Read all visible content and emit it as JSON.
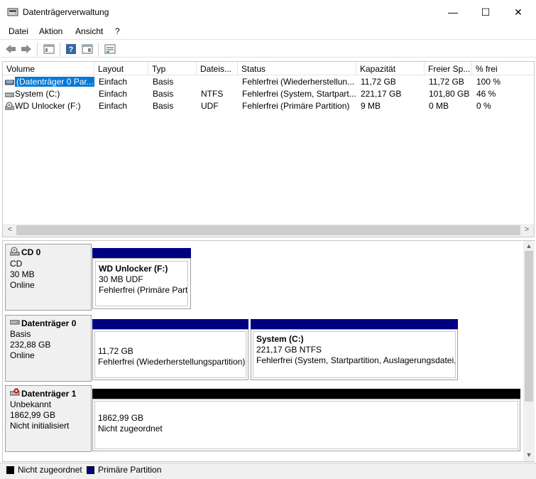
{
  "window": {
    "title": "Datenträgerverwaltung",
    "minimize": "—",
    "maximize": "☐",
    "close": "✕"
  },
  "menu": [
    "Datei",
    "Aktion",
    "Ansicht",
    "?"
  ],
  "toolbar": {
    "icons": [
      "back-icon",
      "forward-icon",
      "properties-icon",
      "help-icon",
      "show-hide-icon",
      "view-icon"
    ]
  },
  "volume_list": {
    "columns": [
      "Volume",
      "Layout",
      "Typ",
      "Dateis...",
      "Status",
      "Kapazität",
      "Freier Sp...",
      "% frei"
    ],
    "rows": [
      {
        "volume": "(Datenträger 0 Par...",
        "layout": "Einfach",
        "typ": "Basis",
        "fs": "",
        "status": "Fehlerfrei (Wiederherstellun...",
        "capacity": "11,72 GB",
        "free": "11,72 GB",
        "pct": "100 %"
      },
      {
        "volume": "System (C:)",
        "layout": "Einfach",
        "typ": "Basis",
        "fs": "NTFS",
        "status": "Fehlerfrei (System, Startpart...",
        "capacity": "221,17 GB",
        "free": "101,80 GB",
        "pct": "46 %"
      },
      {
        "volume": "WD Unlocker (F:)",
        "layout": "Einfach",
        "typ": "Basis",
        "fs": "UDF",
        "status": "Fehlerfrei (Primäre Partition)",
        "capacity": "9 MB",
        "free": "0 MB",
        "pct": "0 %"
      }
    ],
    "scroll_left": "<",
    "scroll_right": ">"
  },
  "disks": {
    "cd0": {
      "name": "CD 0",
      "type": "CD",
      "size": "30 MB",
      "state": "Online",
      "partition": {
        "title": "WD Unlocker  (F:)",
        "detail": "30 MB UDF",
        "status": "Fehlerfrei (Primäre Partit"
      }
    },
    "disk0": {
      "name": "Datenträger 0",
      "type": "Basis",
      "size": "232,88 GB",
      "state": "Online",
      "partitions": [
        {
          "detail": "11,72 GB",
          "status": "Fehlerfrei (Wiederherstellungspartition)"
        },
        {
          "title": "System  (C:)",
          "detail": "221,17 GB NTFS",
          "status": "Fehlerfrei (System, Startpartition, Auslagerungsdatei,"
        }
      ]
    },
    "disk1": {
      "name": "Datenträger 1",
      "type": "Unbekannt",
      "size": "1862,99 GB",
      "state": "Nicht initialisiert",
      "partition": {
        "detail": "1862,99 GB",
        "status": "Nicht zugeordnet"
      }
    }
  },
  "legend": [
    {
      "label": "Nicht zugeordnet",
      "color": "#000000"
    },
    {
      "label": "Primäre Partition",
      "color": "#000080"
    }
  ],
  "colors": {
    "primary_partition": "#000080",
    "unallocated": "#000000",
    "selection": "#0078d7"
  }
}
